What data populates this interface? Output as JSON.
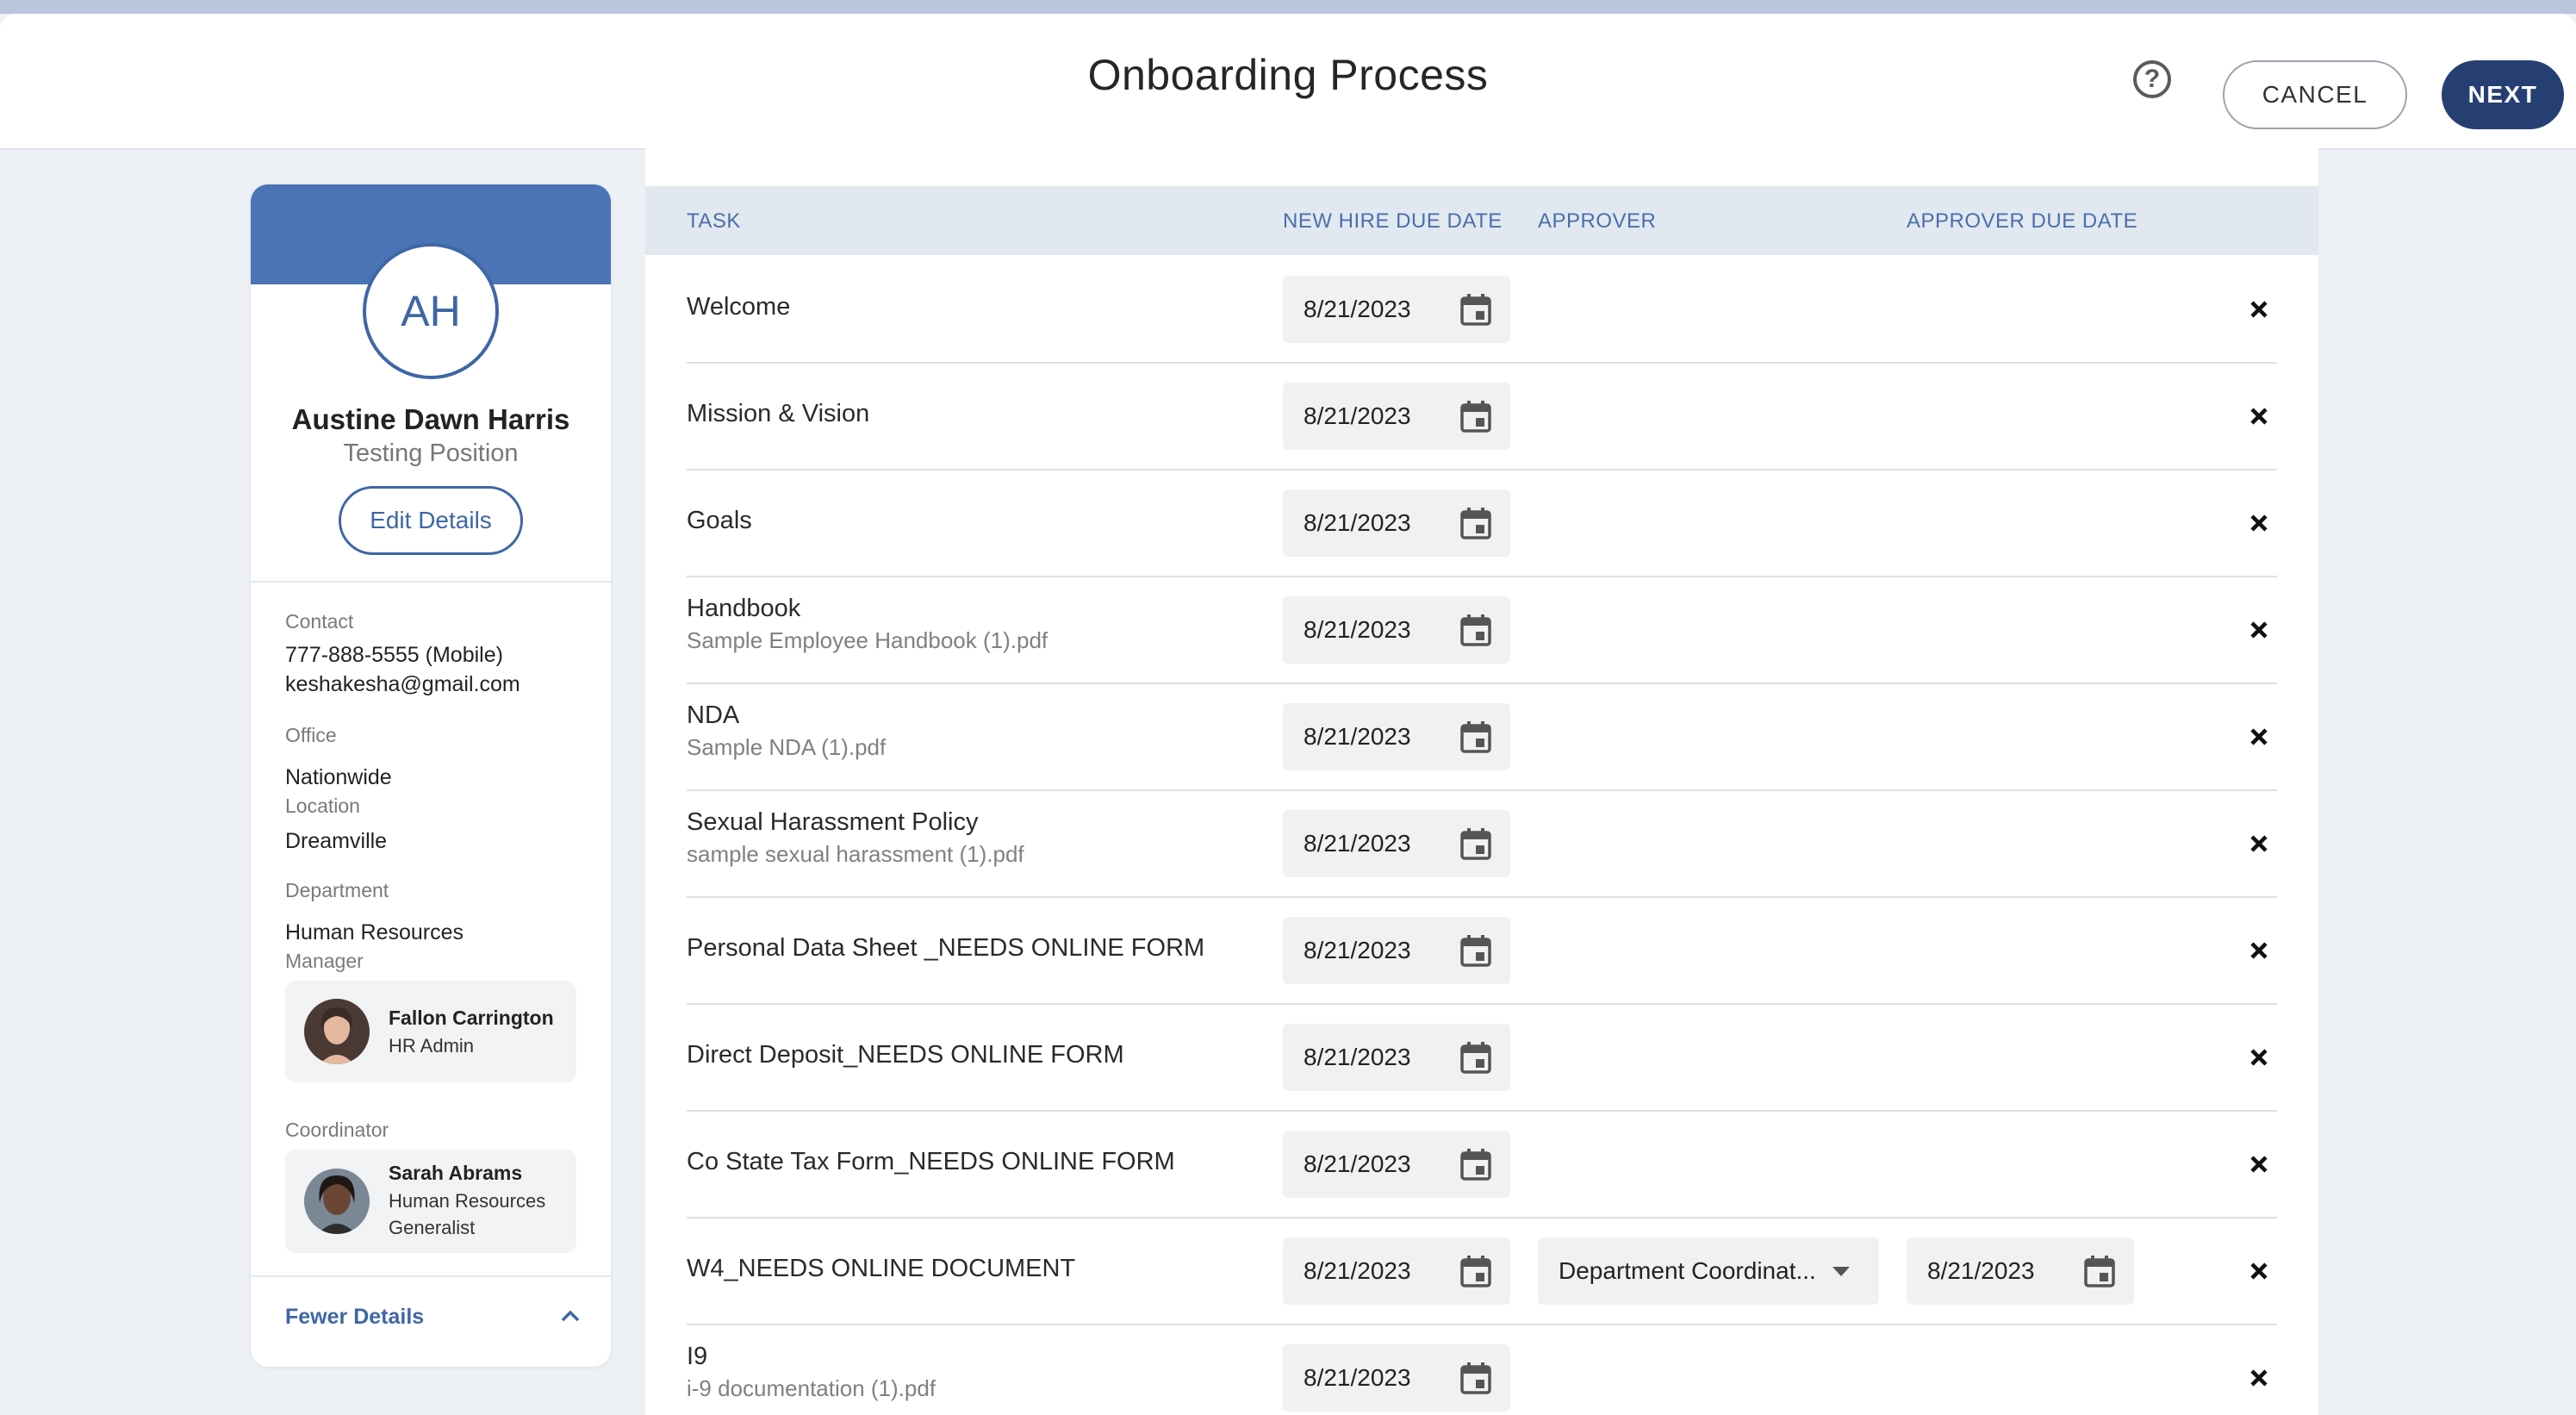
{
  "header": {
    "title": "Onboarding Process",
    "cancel_label": "CANCEL",
    "next_label": "NEXT",
    "help_glyph": "?"
  },
  "profile": {
    "initials": "AH",
    "name": "Austine Dawn Harris",
    "position": "Testing Position",
    "edit_label": "Edit Details",
    "contact_label": "Contact",
    "phone": "777-888-5555 (Mobile)",
    "email": "keshakesha@gmail.com",
    "office_label": "Office",
    "office": "Nationwide",
    "location_label": "Location",
    "location": "Dreamville",
    "department_label": "Department",
    "department": "Human Resources",
    "manager_label": "Manager",
    "manager": {
      "name": "Fallon Carrington",
      "role": "HR Admin"
    },
    "coordinator_label": "Coordinator",
    "coordinator": {
      "name": "Sarah Abrams",
      "role": "Human Resources Generalist"
    },
    "fewer_label": "Fewer Details"
  },
  "table": {
    "columns": {
      "task": "TASK",
      "new_hire_due": "NEW HIRE DUE DATE",
      "approver": "APPROVER",
      "approver_due": "APPROVER DUE DATE"
    },
    "rows": [
      {
        "name": "Welcome",
        "file": "",
        "due": "8/21/2023"
      },
      {
        "name": "Mission & Vision",
        "file": "",
        "due": "8/21/2023"
      },
      {
        "name": "Goals",
        "file": "",
        "due": "8/21/2023"
      },
      {
        "name": "Handbook",
        "file": "Sample Employee Handbook (1).pdf",
        "due": "8/21/2023"
      },
      {
        "name": "NDA",
        "file": "Sample NDA (1).pdf",
        "due": "8/21/2023"
      },
      {
        "name": "Sexual Harassment Policy",
        "file": "sample sexual harassment (1).pdf",
        "due": "8/21/2023"
      },
      {
        "name": "Personal Data Sheet _NEEDS ONLINE FORM",
        "file": "",
        "due": "8/21/2023"
      },
      {
        "name": "Direct Deposit_NEEDS ONLINE FORM",
        "file": "",
        "due": "8/21/2023"
      },
      {
        "name": "Co State Tax Form_NEEDS ONLINE FORM",
        "file": "",
        "due": "8/21/2023"
      },
      {
        "name": "W4_NEEDS ONLINE DOCUMENT",
        "file": "",
        "due": "8/21/2023",
        "approver": "Department Coordinat...",
        "approver_due": "8/21/2023"
      },
      {
        "name": "I9",
        "file": "i-9 documentation (1).pdf",
        "due": "8/21/2023"
      }
    ]
  },
  "colors": {
    "brand": "#263f73",
    "accent": "#3f66a6",
    "banner": "#4b74b6"
  },
  "icons": {
    "calendar": "calendar-icon",
    "remove": "close-icon",
    "help": "help-icon",
    "chevron": "chevron-up-icon"
  }
}
